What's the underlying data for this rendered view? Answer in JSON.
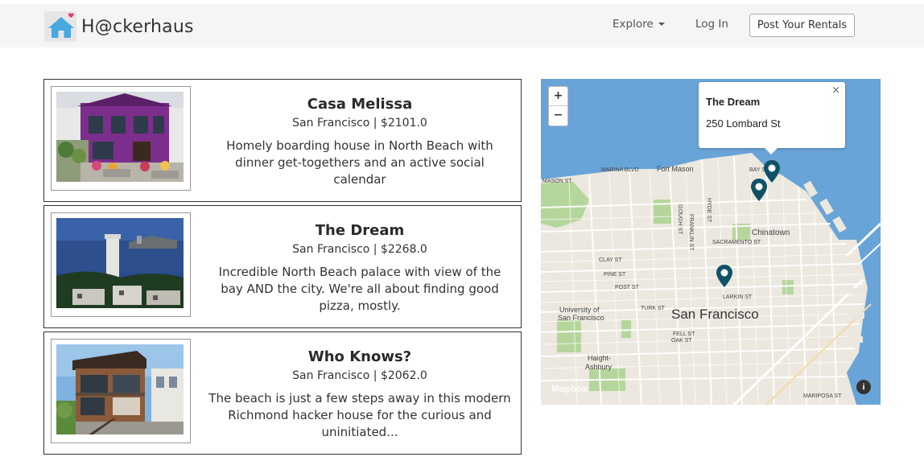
{
  "nav": {
    "brand": "H@ckerhaus",
    "explore": "Explore",
    "login": "Log In",
    "post": "Post Your Rentals"
  },
  "listings": [
    {
      "title": "Casa Melissa",
      "subtitle": "San Francisco | $2101.0",
      "description": "Homely boarding house in North Beach with dinner get-togethers and an active social calendar"
    },
    {
      "title": "The Dream",
      "subtitle": "San Francisco | $2268.0",
      "description": "Incredible North Beach palace with view of the bay AND the city. We're all about finding good pizza, mostly."
    },
    {
      "title": "Who Knows?",
      "subtitle": "San Francisco | $2062.0",
      "description": "The beach is just a few steps away in this modern Richmond hacker house for the curious and uninitiated..."
    }
  ],
  "map": {
    "zoom_in": "+",
    "zoom_out": "−",
    "popup": {
      "title": "The Dream",
      "address": "250 Lombard St",
      "close": "×"
    },
    "attribution": "Mapbox",
    "info": "i",
    "labels": {
      "city": "San Francisco",
      "chinatown": "Chinatown",
      "fort_mason": "Fort Mason",
      "haight": "Haight-",
      "ashbury": "Ashbury",
      "university_1": "University of",
      "university_2": "San Francisco",
      "marina": "MARINA BLVD",
      "mason": "MASON ST",
      "bay": "BAY S",
      "hyde": "HYDE ST",
      "franklin": "FRANKLIN ST",
      "gough": "GOUGH ST",
      "sacramento": "SACRAMENTO ST",
      "clay": "CLAY ST",
      "pine": "PINE ST",
      "post": "POST ST",
      "turk": "TURK ST",
      "fell": "FELL ST",
      "oak": "OAK ST",
      "larkin": "LARKIN ST",
      "mariposa": "MARIPOSA ST"
    }
  },
  "colors": {
    "water": "#68a4d8",
    "land": "#ece8df",
    "park": "#b5d69b",
    "marker": "#0f5268"
  }
}
